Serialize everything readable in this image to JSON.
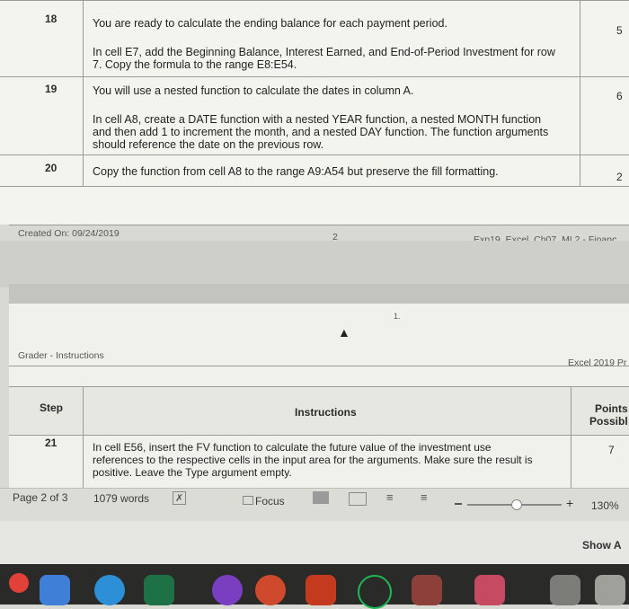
{
  "rows": [
    {
      "step": "18",
      "lines": [
        "You are ready to calculate the ending balance for each payment period."
      ],
      "lines2": [
        "In cell E7, add the Beginning Balance, Interest Earned, and End-of-Period Investment for row",
        "7. Copy the formula to the range E8:E54."
      ],
      "points": "5"
    },
    {
      "step": "19",
      "lines": [
        "You will use a nested function to calculate the dates in column A."
      ],
      "lines2": [
        "In cell A8, create a DATE function with a nested YEAR function, a nested MONTH function",
        "and then add 1 to increment the month, and a nested DAY function. The function arguments",
        "should reference the date on the previous row."
      ],
      "points": "6"
    },
    {
      "step": "20",
      "lines": [
        "Copy the function from cell A8 to the range A9:A54 but preserve the fill formatting."
      ],
      "lines2": [],
      "points": "2"
    }
  ],
  "footer": {
    "created": "Created On: 09/24/2019",
    "page_num": "2",
    "filename": "Exp19_Excel_Ch07_ML2 - Financ"
  },
  "stray_mark": "1.",
  "header": {
    "left": "Grader - Instructions",
    "right": "Excel 2019 Pr"
  },
  "table2": {
    "col_step": "Step",
    "col_instructions": "Instructions",
    "col_points": [
      "Points",
      "Possibl"
    ],
    "row": {
      "step": "21",
      "lines": [
        "In cell E56, insert the FV function to calculate the future value of the investment use",
        "references to the respective cells in the input area for the arguments. Make sure the result is",
        "positive. Leave the Type argument empty."
      ],
      "points": "7"
    }
  },
  "status": {
    "page": "Page 2 of 3",
    "words": "1079 words",
    "focus": "Focus",
    "zoom": "130%"
  },
  "show_button": "Show A"
}
